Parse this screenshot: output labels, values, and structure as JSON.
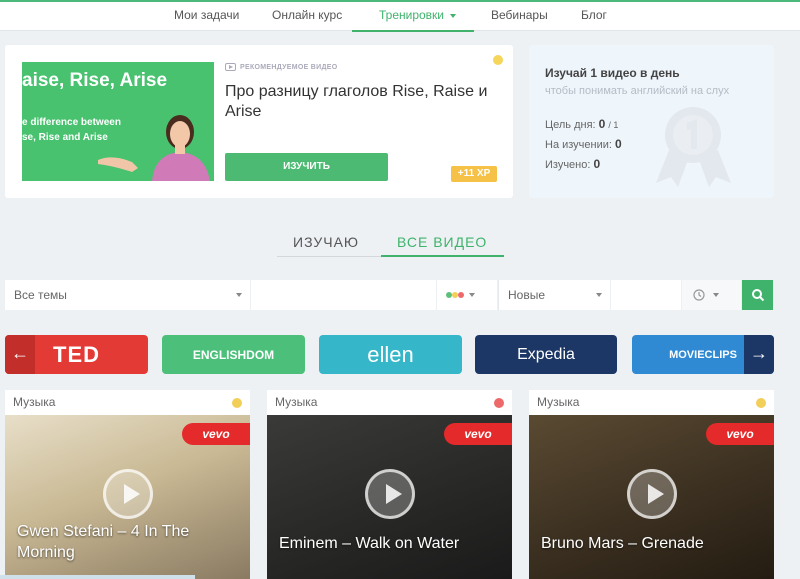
{
  "nav": {
    "items": [
      {
        "label": "Мои задачи"
      },
      {
        "label": "Онлайн курс"
      },
      {
        "label": "Тренировки"
      },
      {
        "label": "Вебинары"
      },
      {
        "label": "Блог"
      }
    ],
    "active": "Тренировки"
  },
  "hero": {
    "thumb_title": "aise, Rise, Arise",
    "thumb_line1": "e difference between",
    "thumb_line2": "se, Rise and Arise",
    "recommended_label": "РЕКОМЕНДУЕМОЕ ВИДЕО",
    "title": "Про разницу глаголов Rise, Raise и Arise",
    "button_label": "ИЗУЧИТЬ",
    "xp_badge": "+11 XP"
  },
  "daily": {
    "title": "Изучай 1 видео в день",
    "subtitle": "чтобы понимать английский на слух",
    "goal_label": "Цель дня:",
    "goal_value": "0",
    "goal_total": "/ 1",
    "studying_label": "На изучении:",
    "studying_value": "0",
    "learned_label": "Изучено:",
    "learned_value": "0"
  },
  "tabs": {
    "studying": "ИЗУЧАЮ",
    "all_videos": "ВСЕ ВИДЕО",
    "active": "ВСЕ ВИДЕО"
  },
  "filters": {
    "topics": "Все темы",
    "sort": "Новые"
  },
  "channels": [
    {
      "name": "TED",
      "color": "#e43a36"
    },
    {
      "name": "ENGLISHDOM",
      "color": "#4cc07a"
    },
    {
      "name": "ellen",
      "color": "#35b6c9"
    },
    {
      "name": "Expedia",
      "color": "#1c3766"
    },
    {
      "name": "MOVIECLIPS",
      "color": "#2f8ad3"
    }
  ],
  "videos": [
    {
      "category": "Музыка",
      "title": "Gwen Stefani – 4 In The Morning",
      "badge": "vevo",
      "dot_color": "#f2cf58"
    },
    {
      "category": "Музыка",
      "title": "Eminem – Walk on Water",
      "badge": "vevo",
      "dot_color": "#ee6a6a"
    },
    {
      "category": "Музыка",
      "title": "Bruno Mars – Grenade",
      "badge": "vevo",
      "dot_color": "#f2cf58"
    }
  ],
  "colors": {
    "accent": "#3fb36c",
    "xp": "#f5c146",
    "vevo": "#e42a2a"
  },
  "icons": [
    "video-icon",
    "medal-icon",
    "clock-icon",
    "search-icon",
    "play-icon",
    "arrow-left-icon",
    "arrow-right-icon",
    "chevron-down-icon"
  ]
}
